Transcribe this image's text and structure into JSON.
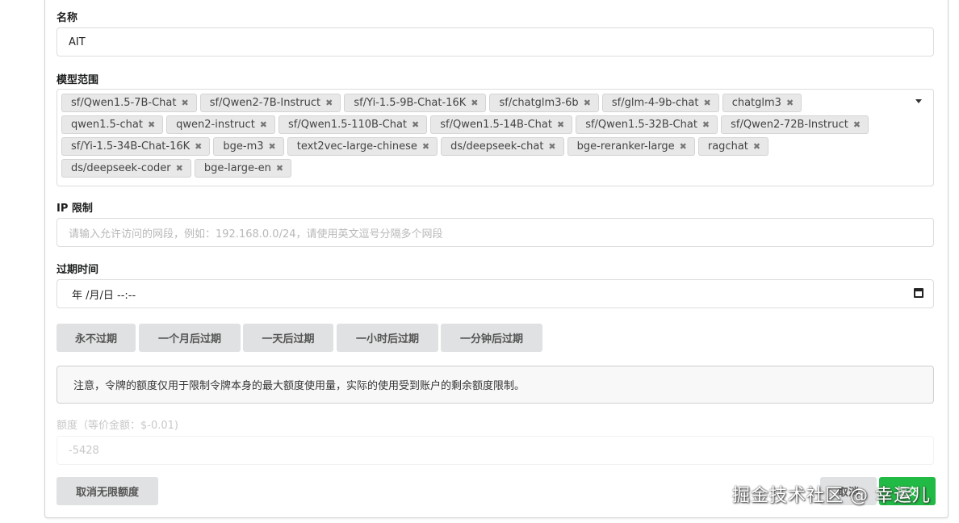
{
  "form": {
    "name_label": "名称",
    "name_value": "AIT",
    "models_label": "模型范围",
    "models": [
      "sf/Qwen1.5-7B-Chat",
      "sf/Qwen2-7B-Instruct",
      "sf/Yi-1.5-9B-Chat-16K",
      "sf/chatglm3-6b",
      "sf/glm-4-9b-chat",
      "chatglm3",
      "qwen1.5-chat",
      "qwen2-instruct",
      "sf/Qwen1.5-110B-Chat",
      "sf/Qwen1.5-14B-Chat",
      "sf/Qwen1.5-32B-Chat",
      "sf/Qwen2-72B-Instruct",
      "sf/Yi-1.5-34B-Chat-16K",
      "bge-m3",
      "text2vec-large-chinese",
      "ds/deepseek-chat",
      "bge-reranker-large",
      "ragchat",
      "ds/deepseek-coder",
      "bge-large-en"
    ],
    "tag_remove_icon": "✖",
    "ip_label": "IP 限制",
    "ip_placeholder": "请输入允许访问的网段，例如：192.168.0.0/24，请使用英文逗号分隔多个网段",
    "expire_label": "过期时间",
    "expire_value": "年 /月/日 --:--",
    "expire_buttons": [
      "永不过期",
      "一个月后过期",
      "一天后过期",
      "一小时后过期",
      "一分钟后过期"
    ],
    "notice": "注意，令牌的额度仅用于限制令牌本身的最大额度使用量，实际的使用受到账户的剩余额度限制。",
    "quota_label": "额度（等价金额：$-0.01)",
    "quota_value": "-5428",
    "unlimited_button": "取消无限额度",
    "cancel_button": "取消",
    "submit_button": "提交"
  },
  "watermark": "掘金技术社区 @ 幸运儿",
  "colors": {
    "submit": "#21ba45",
    "button_gray": "#e0e1e2"
  }
}
